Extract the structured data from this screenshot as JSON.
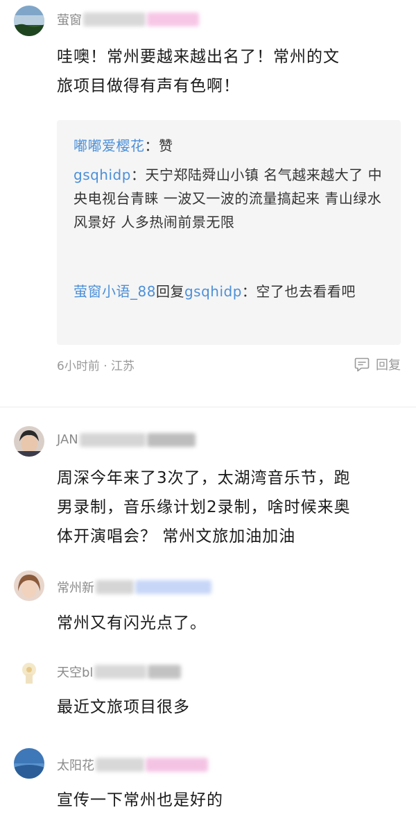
{
  "comments": [
    {
      "username": "萤窗",
      "text_lines": [
        "哇噢！常州要越来越出名了！常州的文",
        "旅项目做得有声有色啊！"
      ],
      "replies": [
        {
          "name": "嘟嘟爱樱花",
          "sep": "：",
          "content": "赞"
        },
        {
          "name": "gsqhidp",
          "sep": "：",
          "content": "天宁郑陆舜山小镇 名气越来越大了 中央电视台青睐 一波又一波的流量搞起来 青山绿水风景好 人多热闹前景无限"
        },
        {
          "name": "萤窗小语_88",
          "mid": "回复",
          "target": "gsqhidp",
          "sep": "：",
          "content": "空了也去看看吧"
        }
      ],
      "meta": "6小时前 · 江苏",
      "reply_label": "回复"
    },
    {
      "username": "JAN",
      "text_lines": [
        "周深今年来了3次了，太湖湾音乐节，跑",
        "男录制，音乐缘计划2录制，啥时候来奥",
        "体开演唱会？ 常州文旅加油加油"
      ]
    },
    {
      "username": "常州新",
      "text_lines": [
        "常州又有闪光点了。"
      ]
    },
    {
      "username": "天空bl",
      "text_lines": [
        "最近文旅项目很多"
      ]
    },
    {
      "username": "太阳花",
      "text_lines": [
        "宣传一下常州也是好的"
      ]
    }
  ],
  "colors": {
    "link": "#4b8fd8",
    "meta": "#999999",
    "reply_bg": "#f5f5f5",
    "text": "#1a1a1a"
  },
  "icons": {
    "reply": "speech-bubble-icon"
  }
}
